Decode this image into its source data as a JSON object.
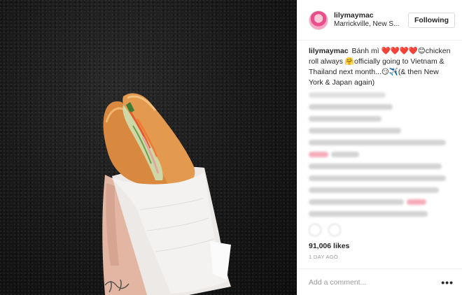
{
  "post": {
    "username": "lilymaymac",
    "location": "Marrickville, New S...",
    "follow_label": "Following",
    "caption_user": "lilymaymac",
    "caption_text": "Bánh mì ❤️❤️❤️❤️😊chicken roll always 🤗officially going to Vietnam & Thailand next month...😏✈️(& then New York & Japan again)",
    "likes": "91,006 likes",
    "time": "1 DAY AGO",
    "comment_placeholder": "Add a comment...",
    "more_label": "•••"
  },
  "colors": {
    "background": "#ffffff",
    "border": "#efefef",
    "text": "#262626",
    "muted": "#999999",
    "photo_bg": "#161616"
  }
}
